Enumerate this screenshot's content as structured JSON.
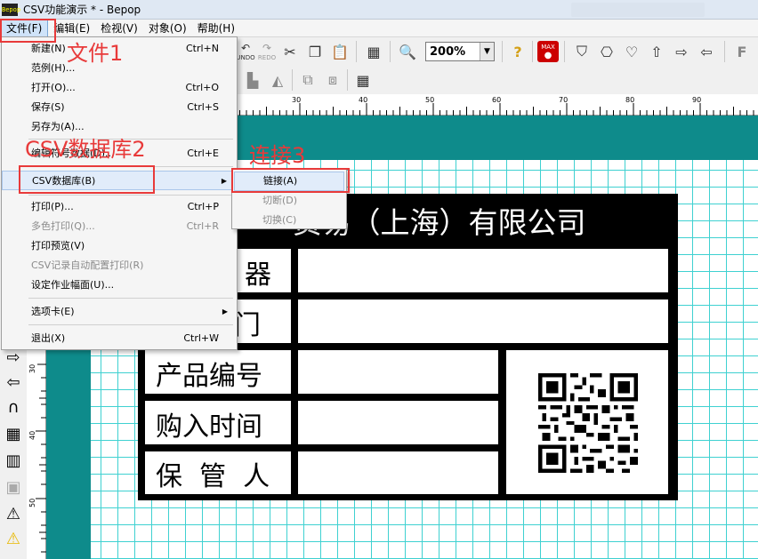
{
  "window": {
    "title": "CSV功能演示 * - Bepop",
    "icon_text": "Bepop"
  },
  "menubar": [
    {
      "label": "文件(F)",
      "active": true
    },
    {
      "label": "编辑(E)"
    },
    {
      "label": "检视(V)"
    },
    {
      "label": "对象(O)"
    },
    {
      "label": "帮助(H)"
    }
  ],
  "toolbar": {
    "zoom_value": "200%",
    "undo_text": "UNDO",
    "redo_text": "REDO",
    "max_text": "MAX"
  },
  "ruler": {
    "h_labels": [
      "30",
      "40",
      "50",
      "60",
      "70",
      "80",
      "90"
    ],
    "v_labels": [
      "30",
      "40",
      "50"
    ]
  },
  "file_menu": {
    "items": [
      {
        "label": "新建(N)",
        "shortcut": "Ctrl+N"
      },
      {
        "label": "范例(H)...",
        "shortcut": ""
      },
      {
        "label": "打开(O)...",
        "shortcut": "Ctrl+O"
      },
      {
        "label": "保存(S)",
        "shortcut": "Ctrl+S"
      },
      {
        "label": "另存为(A)...",
        "shortcut": ""
      },
      {
        "label": "编辑符号数据(D)...",
        "shortcut": "Ctrl+E"
      },
      {
        "label": "CSV数据库(B)",
        "shortcut": ""
      },
      {
        "label": "打印(P)...",
        "shortcut": "Ctrl+P"
      },
      {
        "label": "多色打印(Q)...",
        "shortcut": "Ctrl+R"
      },
      {
        "label": "打印预览(V)",
        "shortcut": ""
      },
      {
        "label": "CSV记录自动配置打印(R)",
        "shortcut": ""
      },
      {
        "label": "设定作业幅面(U)...",
        "shortcut": ""
      },
      {
        "label": "选项卡(E)",
        "shortcut": ""
      },
      {
        "label": "退出(X)",
        "shortcut": "Ctrl+W"
      }
    ]
  },
  "csv_submenu": {
    "items": [
      {
        "label": "链接(A)"
      },
      {
        "label": "切断(D)"
      },
      {
        "label": "切换(C)"
      }
    ]
  },
  "label": {
    "header": "贸易（上海）有限公司",
    "row1": "器",
    "row2": "门",
    "row3": "产品编号",
    "row4": "购入时间",
    "row5": "保  管  人"
  },
  "annotations": {
    "step1": "文件1",
    "step2": "CSV数据库2",
    "step3": "连接3"
  },
  "colors": {
    "annotation": "#e83a3a",
    "grid": "#3fd1d1",
    "teal": "#0e8b8b"
  }
}
